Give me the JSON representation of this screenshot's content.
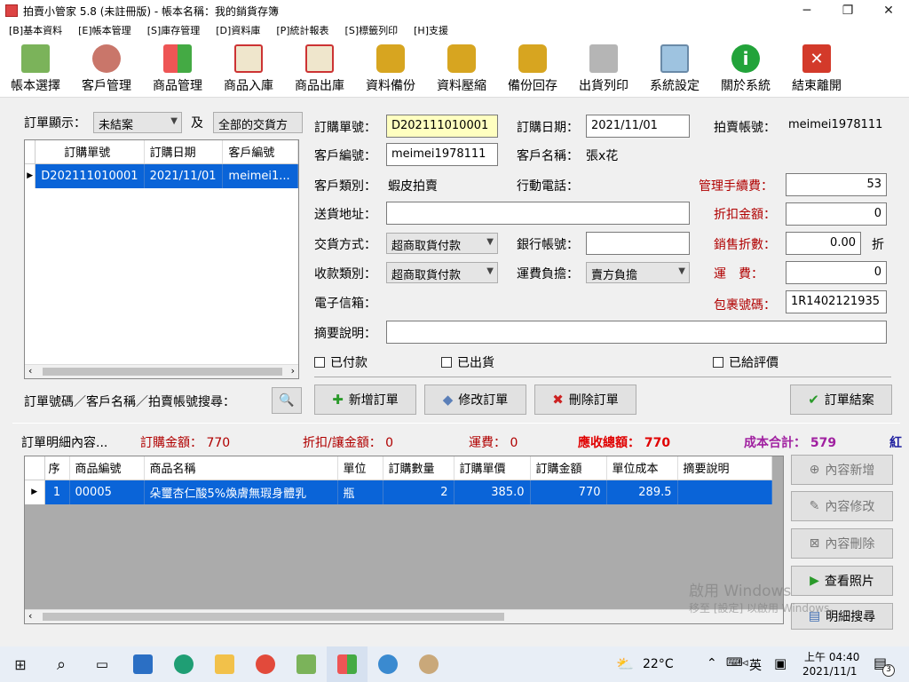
{
  "window": {
    "title": "拍賣小管家 5.8 (未註冊版) - 帳本名稱：我的銷貨存簿"
  },
  "menu": [
    "[B]基本資料",
    "[E]帳本管理",
    "[S]庫存管理",
    "[D]資料庫",
    "[P]統計報表",
    "[S]標籤列印",
    "[H]支援"
  ],
  "toolbar": [
    {
      "label": "帳本選擇",
      "icon": "books-icon",
      "color": "#7bb35a"
    },
    {
      "label": "客戶管理",
      "icon": "users-icon",
      "color": "#c9766a"
    },
    {
      "label": "商品管理",
      "icon": "product-grid-icon",
      "color": "#e5a23a"
    },
    {
      "label": "商品入庫",
      "icon": "stock-in-icon",
      "color": "#d9d0b8"
    },
    {
      "label": "商品出庫",
      "icon": "stock-out-icon",
      "color": "#d9d0b8"
    },
    {
      "label": "資料備份",
      "icon": "database-backup-icon",
      "color": "#d7a520"
    },
    {
      "label": "資料壓縮",
      "icon": "database-compress-icon",
      "color": "#d7a520"
    },
    {
      "label": "備份回存",
      "icon": "database-restore-icon",
      "color": "#d7a520"
    },
    {
      "label": "出貨列印",
      "icon": "printer-icon",
      "color": "#9a9a9a"
    },
    {
      "label": "系統設定",
      "icon": "monitor-icon",
      "color": "#7fa6c8"
    },
    {
      "label": "關於系統",
      "icon": "info-icon",
      "color": "#22a33a"
    },
    {
      "label": "結束離開",
      "icon": "exit-icon",
      "color": "#d33a2a"
    }
  ],
  "left_panel": {
    "display_label": "訂單顯示：",
    "status_filter": "未結案",
    "and_label": "及",
    "delivery_filter": "全部的交貨方",
    "columns": [
      "訂購單號",
      "訂購日期",
      "客戶編號"
    ],
    "rows": [
      [
        "D202111010001",
        "2021/11/01",
        "meimei1..."
      ]
    ],
    "search_label": "訂單號碼／客戶名稱／拍賣帳號搜尋："
  },
  "order": {
    "order_no_label": "訂購單號：",
    "order_no": "D202111010001",
    "order_date_label": "訂購日期：",
    "order_date": "2021/11/01",
    "auction_account_label": "拍賣帳號：",
    "auction_account": "meimei1978111",
    "customer_id_label": "客戶編號：",
    "customer_id": "meimei1978111",
    "customer_name_label": "客戶名稱：",
    "customer_name": "張x花",
    "customer_type_label": "客戶類別：",
    "customer_type": "蝦皮拍賣",
    "mobile_label": "行動電話：",
    "mgmt_fee_label": "管理手續費：",
    "mgmt_fee": "53",
    "address_label": "送貨地址：",
    "discount_amount_label": "折扣金額：",
    "discount_amount": "0",
    "delivery_method_label": "交貨方式：",
    "delivery_method": "超商取貨付款",
    "bank_account_label": "銀行帳號：",
    "sales_discount_label": "銷售折數：",
    "sales_discount": "0.00",
    "discount_unit": "折",
    "payment_type_label": "收款類別：",
    "payment_type": "超商取貨付款",
    "freight_bearer_label": "運費負擔：",
    "freight_bearer": "賣方負擔",
    "freight_label": "運　費：",
    "freight": "0",
    "email_label": "電子信箱：",
    "parcel_no_label": "包裹號碼：",
    "parcel_no": "1R1402121935",
    "memo_label": "摘要說明：",
    "paid_label": "已付款",
    "shipped_label": "已出貨",
    "reviewed_label": "已給評價",
    "add_btn": "新增訂單",
    "edit_btn": "修改訂單",
    "delete_btn": "刪除訂單",
    "close_btn": "訂單結案"
  },
  "summary": {
    "detail_label": "訂單明細內容...",
    "order_amount": "訂購金額： 770",
    "discount": "折扣/讓金額： 0",
    "freight": "運費： 0",
    "receivable": "應收總額： 770",
    "cost_total": "成本合計： 579",
    "extra": "紅"
  },
  "detail": {
    "columns": [
      "序",
      "商品編號",
      "商品名稱",
      "單位",
      "訂購數量",
      "訂購單價",
      "訂購金額",
      "單位成本",
      "摘要說明"
    ],
    "rows": [
      [
        "1",
        "00005",
        "朵璽杏仁酸5%煥膚無瑕身體乳",
        "瓶",
        "2",
        "385.0",
        "770",
        "289.5",
        ""
      ]
    ],
    "buttons": [
      "內容新增",
      "內容修改",
      "內容刪除",
      "查看照片",
      "明細搜尋"
    ]
  },
  "watermark": {
    "line1": "啟用 Windows",
    "line2": "移至 [設定] 以啟用 Windows。"
  },
  "taskbar": {
    "temp": "22°C",
    "ime": "英",
    "time": "上午 04:40",
    "date": "2021/11/1",
    "notif": "3"
  }
}
